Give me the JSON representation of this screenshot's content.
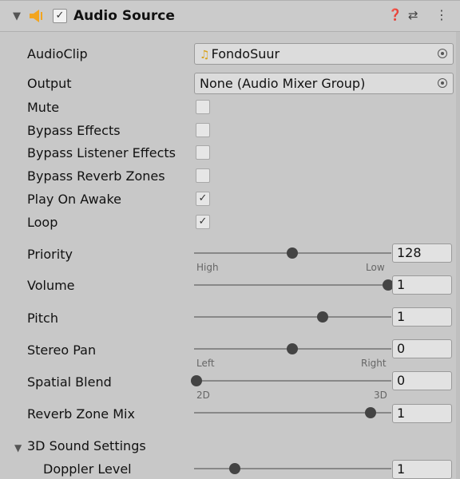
{
  "header": {
    "title": "Audio Source",
    "enabled_check": "✓",
    "icons": [
      "fold-triangle-icon",
      "audio-source-speaker-icon",
      "help-icon",
      "presets-icon",
      "kebab-menu-icon"
    ]
  },
  "fields": {
    "audio_clip_label": "AudioClip",
    "audio_clip_value": "FondoSuur",
    "output_label": "Output",
    "output_value": "None (Audio Mixer Group)"
  },
  "toggles": [
    {
      "label": "Mute",
      "checked": false,
      "mark": ""
    },
    {
      "label": "Bypass Effects",
      "checked": false,
      "mark": ""
    },
    {
      "label": "Bypass Listener Effects",
      "checked": false,
      "mark": ""
    },
    {
      "label": "Bypass Reverb Zones",
      "checked": false,
      "mark": ""
    },
    {
      "label": "Play On Awake",
      "checked": true,
      "mark": "✓"
    },
    {
      "label": "Loop",
      "checked": true,
      "mark": "✓"
    }
  ],
  "sliders": [
    {
      "label": "Priority",
      "value": "128",
      "fraction": 0.5,
      "left_hint": "High",
      "right_hint": "Low"
    },
    {
      "label": "Volume",
      "value": "1",
      "fraction": 1.0
    },
    {
      "label": "Pitch",
      "value": "1",
      "fraction": 0.66
    },
    {
      "label": "Stereo Pan",
      "value": "0",
      "fraction": 0.5,
      "left_hint": "Left",
      "right_hint": "Right"
    },
    {
      "label": "Spatial Blend",
      "value": "0",
      "fraction": 0.0,
      "left_hint": "2D",
      "right_hint": "3D"
    },
    {
      "label": "Reverb Zone Mix",
      "value": "1",
      "fraction": 0.91
    }
  ],
  "section_3d": {
    "title": "3D Sound Settings",
    "doppler_label": "Doppler Level",
    "doppler_value": "1",
    "doppler_fraction": 0.2
  },
  "colors": {
    "speaker": "#f2a51f",
    "knob": "#444444"
  }
}
